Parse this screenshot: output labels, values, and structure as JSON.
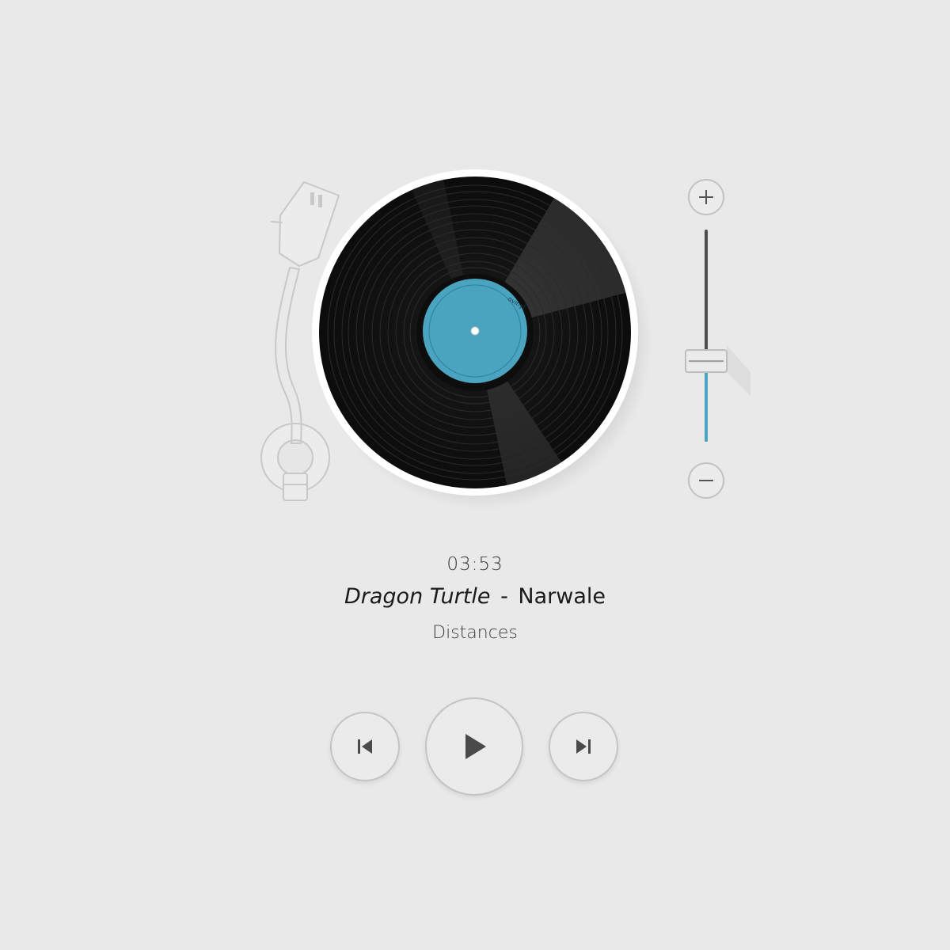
{
  "player": {
    "time": "03:53",
    "track": {
      "title": "Dragon Turtle",
      "separator": "-",
      "artist": "Narwale"
    },
    "album": "Distances",
    "record_label_text": "ovinyl",
    "volume_level": 0.38
  },
  "controls": {
    "volume_up_icon": "plus-icon",
    "volume_down_icon": "minus-icon",
    "previous_icon": "skip-previous-icon",
    "play_icon": "play-icon",
    "next_icon": "skip-next-icon"
  },
  "colors": {
    "background": "#e9e9e9",
    "accent": "#4aa3bf",
    "label": "#4aa3bf",
    "vinyl": "#111111",
    "outline": "#c2c2c2"
  }
}
